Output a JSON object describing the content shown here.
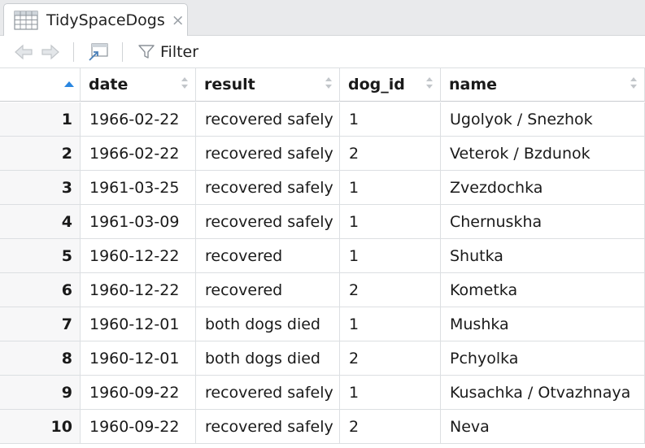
{
  "tab": {
    "title": "TidySpaceDogs",
    "close": "×"
  },
  "toolbar": {
    "filter_label": "Filter"
  },
  "columns": [
    "date",
    "result",
    "dog_id",
    "name"
  ],
  "rows": [
    {
      "n": "1",
      "date": "1966-02-22",
      "result": "recovered safely",
      "dog_id": "1",
      "name": "Ugolyok / Snezhok"
    },
    {
      "n": "2",
      "date": "1966-02-22",
      "result": "recovered safely",
      "dog_id": "2",
      "name": "Veterok / Bzdunok"
    },
    {
      "n": "3",
      "date": "1961-03-25",
      "result": "recovered safely",
      "dog_id": "1",
      "name": "Zvezdochka"
    },
    {
      "n": "4",
      "date": "1961-03-09",
      "result": "recovered safely",
      "dog_id": "1",
      "name": "Chernuskha"
    },
    {
      "n": "5",
      "date": "1960-12-22",
      "result": "recovered",
      "dog_id": "1",
      "name": "Shutka"
    },
    {
      "n": "6",
      "date": "1960-12-22",
      "result": "recovered",
      "dog_id": "2",
      "name": "Kometka"
    },
    {
      "n": "7",
      "date": "1960-12-01",
      "result": "both dogs died",
      "dog_id": "1",
      "name": "Mushka"
    },
    {
      "n": "8",
      "date": "1960-12-01",
      "result": "both dogs died",
      "dog_id": "2",
      "name": "Pchyolka"
    },
    {
      "n": "9",
      "date": "1960-09-22",
      "result": "recovered safely",
      "dog_id": "1",
      "name": "Kusachka / Otvazhnaya"
    },
    {
      "n": "10",
      "date": "1960-09-22",
      "result": "recovered safely",
      "dog_id": "2",
      "name": "Neva"
    }
  ],
  "icons": {
    "tab": "table-grid-icon",
    "back": "back-arrow-icon",
    "forward": "forward-arrow-icon",
    "popout": "popout-window-icon",
    "filter": "filter-funnel-icon",
    "sort_active": "sort-ascending-icon",
    "sort": "sort-icon"
  },
  "colors": {
    "sort_active": "#2a86e0",
    "icon_gray": "#c2c6ca"
  }
}
